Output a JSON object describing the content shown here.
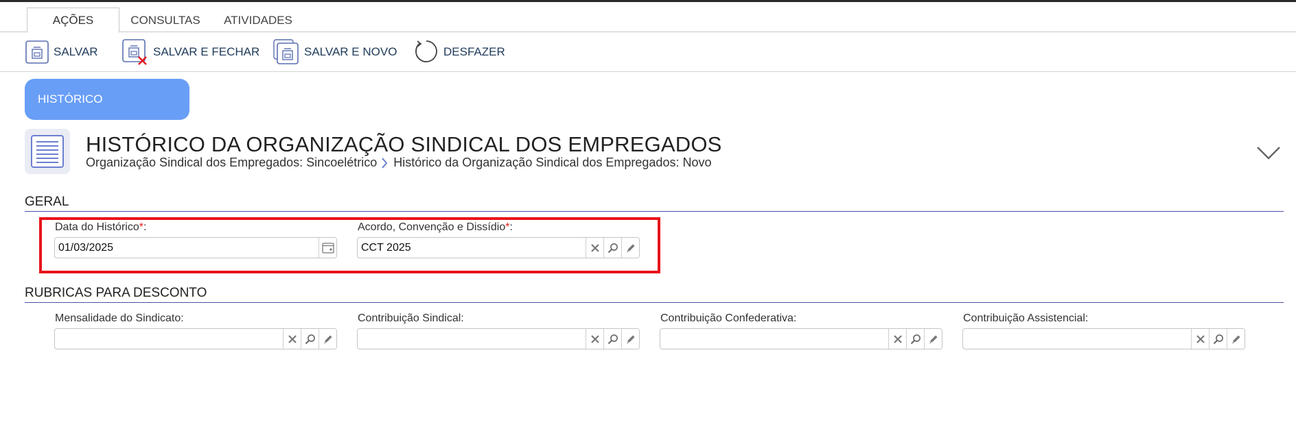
{
  "tabs": [
    {
      "label": "AÇÕES",
      "active": true
    },
    {
      "label": "CONSULTAS",
      "active": false
    },
    {
      "label": "ATIVIDADES",
      "active": false
    }
  ],
  "toolbar": {
    "salvar": "SALVAR",
    "salvar_fechar": "SALVAR E FECHAR",
    "salvar_novo": "SALVAR E NOVO",
    "desfazer": "DESFAZER"
  },
  "section_pill": "HISTÓRICO",
  "header": {
    "title": "HISTÓRICO DA ORGANIZAÇÃO SINDICAL DOS EMPREGADOS",
    "breadcrumb": [
      "Organização Sindical dos Empregados: Sincoelétrico",
      "Histórico da Organização Sindical dos Empregados: Novo"
    ]
  },
  "geral": {
    "title": "GERAL",
    "data_historico": {
      "label": "Data do Histórico",
      "required_mark": "*",
      "suffix": ":",
      "value": "01/03/2025"
    },
    "acordo": {
      "label": "Acordo, Convenção e Dissídio",
      "required_mark": "*",
      "suffix": ":",
      "value": "CCT 2025"
    }
  },
  "rubricas": {
    "title": "RUBRICAS PARA DESCONTO",
    "fields": [
      {
        "label": "Mensalidade do Sindicato:",
        "value": ""
      },
      {
        "label": "Contribuição Sindical:",
        "value": ""
      },
      {
        "label": "Contribuição Confederativa:",
        "value": ""
      },
      {
        "label": "Contribuição Assistencial:",
        "value": ""
      }
    ]
  },
  "colors": {
    "accent_pill": "#699ef7",
    "section_line": "#4d4da8",
    "highlight": "#e8141a",
    "required": "#e0201a",
    "toolbar_text": "#1e3a5a"
  },
  "icons": {
    "salvar": "floppy-disk-icon",
    "salvar_fechar": "floppy-disk-close-icon",
    "salvar_novo": "floppy-disk-new-icon",
    "desfazer": "undo-icon",
    "page": "document-lines-icon",
    "collapse": "chevron-down-icon",
    "calendar": "calendar-icon",
    "clear": "clear-x-icon",
    "search": "search-icon",
    "edit": "pencil-icon"
  }
}
